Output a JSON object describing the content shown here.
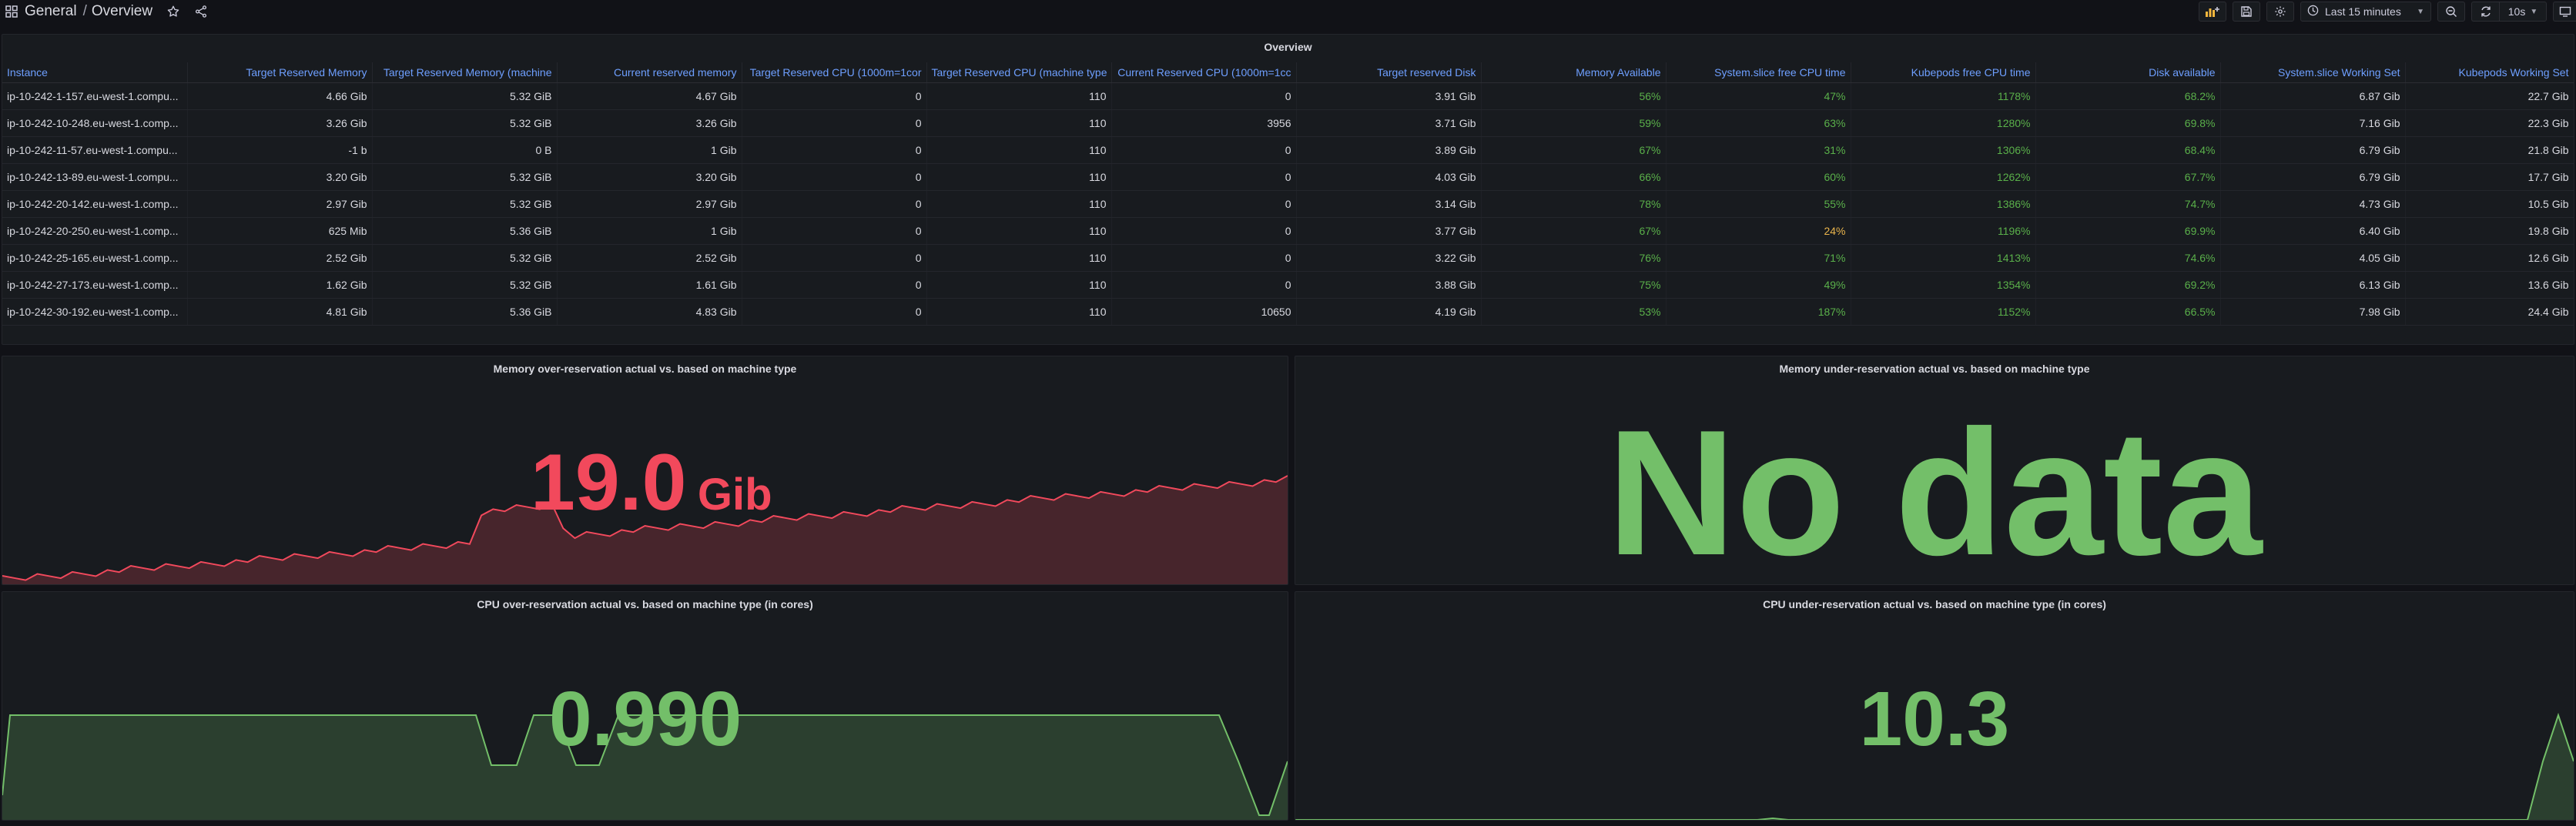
{
  "nav": {
    "breadcrumb_folder": "General",
    "breadcrumb_separator": "/",
    "breadcrumb_dashboard": "Overview",
    "time_range": "Last 15 minutes",
    "refresh_interval": "10s"
  },
  "table": {
    "title": "Overview",
    "columns": [
      "Instance",
      "Target Reserved Memory",
      "Target Reserved Memory (machine",
      "Current reserved memory",
      "Target Reserved CPU (1000m=1cor",
      "Target Reserved CPU (machine type",
      "Current Reserved CPU (1000m=1cc",
      "Target reserved Disk",
      "Memory Available",
      "System.slice free CPU time",
      "Kubepods free CPU time",
      "Disk available",
      "System.slice Working Set",
      "Kubepods Working Set"
    ],
    "rows": [
      [
        "ip-10-242-1-157.eu-west-1.compu...",
        "4.66 Gib",
        "5.32 GiB",
        "4.67 Gib",
        "0",
        "110",
        "0",
        "3.91 Gib",
        "56%",
        "47%",
        "1178%",
        "68.2%",
        "6.87 Gib",
        "22.7 Gib"
      ],
      [
        "ip-10-242-10-248.eu-west-1.comp...",
        "3.26 Gib",
        "5.32 GiB",
        "3.26 Gib",
        "0",
        "110",
        "3956",
        "3.71 Gib",
        "59%",
        "63%",
        "1280%",
        "69.8%",
        "7.16 Gib",
        "22.3 Gib"
      ],
      [
        "ip-10-242-11-57.eu-west-1.compu...",
        "-1 b",
        "0 B",
        "1 Gib",
        "0",
        "110",
        "0",
        "3.89 Gib",
        "67%",
        "31%",
        "1306%",
        "68.4%",
        "6.79 Gib",
        "21.8 Gib"
      ],
      [
        "ip-10-242-13-89.eu-west-1.compu...",
        "3.20 Gib",
        "5.32 GiB",
        "3.20 Gib",
        "0",
        "110",
        "0",
        "4.03 Gib",
        "66%",
        "60%",
        "1262%",
        "67.7%",
        "6.79 Gib",
        "17.7 Gib"
      ],
      [
        "ip-10-242-20-142.eu-west-1.comp...",
        "2.97 Gib",
        "5.32 GiB",
        "2.97 Gib",
        "0",
        "110",
        "0",
        "3.14 Gib",
        "78%",
        "55%",
        "1386%",
        "74.7%",
        "4.73 Gib",
        "10.5 Gib"
      ],
      [
        "ip-10-242-20-250.eu-west-1.comp...",
        "625 Mib",
        "5.36 GiB",
        "1 Gib",
        "0",
        "110",
        "0",
        "3.77 Gib",
        "67%",
        "24%",
        "1196%",
        "69.9%",
        "6.40 Gib",
        "19.8 Gib"
      ],
      [
        "ip-10-242-25-165.eu-west-1.comp...",
        "2.52 Gib",
        "5.32 GiB",
        "2.52 Gib",
        "0",
        "110",
        "0",
        "3.22 Gib",
        "76%",
        "71%",
        "1413%",
        "74.6%",
        "4.05 Gib",
        "12.6 Gib"
      ],
      [
        "ip-10-242-27-173.eu-west-1.comp...",
        "1.62 Gib",
        "5.32 GiB",
        "1.61 Gib",
        "0",
        "110",
        "0",
        "3.88 Gib",
        "75%",
        "49%",
        "1354%",
        "69.2%",
        "6.13 Gib",
        "13.6 Gib"
      ],
      [
        "ip-10-242-30-192.eu-west-1.comp...",
        "4.81 Gib",
        "5.36 GiB",
        "4.83 Gib",
        "0",
        "110",
        "10650",
        "4.19 Gib",
        "53%",
        "187%",
        "1152%",
        "66.5%",
        "7.98 Gib",
        "24.4 Gib"
      ]
    ],
    "cell_colors": {
      "8": "green",
      "9": "green",
      "10": "green",
      "11": "green"
    },
    "highlight": {
      "row": 5,
      "col": 9,
      "color": "orange"
    }
  },
  "panels": {
    "mem_over": {
      "title": "Memory over-reservation actual vs. based on machine type",
      "value": "19.0",
      "unit": "Gib",
      "color": "#f2495c"
    },
    "mem_under": {
      "title": "Memory under-reservation actual vs. based on machine type",
      "value": "No data",
      "color": "#73bf69"
    },
    "cpu_over": {
      "title": "CPU over-reservation actual vs. based on machine type (in cores)",
      "value": "0.990",
      "color": "#73bf69"
    },
    "cpu_under": {
      "title": "CPU under-reservation actual vs. based on machine type (in cores)",
      "value": "10.3",
      "color": "#73bf69"
    }
  },
  "colors": {
    "background": "#111217",
    "panel": "#181b1f",
    "header_text": "#6e9fff",
    "good": "#73bf69",
    "warn": "#e9b44c",
    "bad": "#f2495c"
  }
}
